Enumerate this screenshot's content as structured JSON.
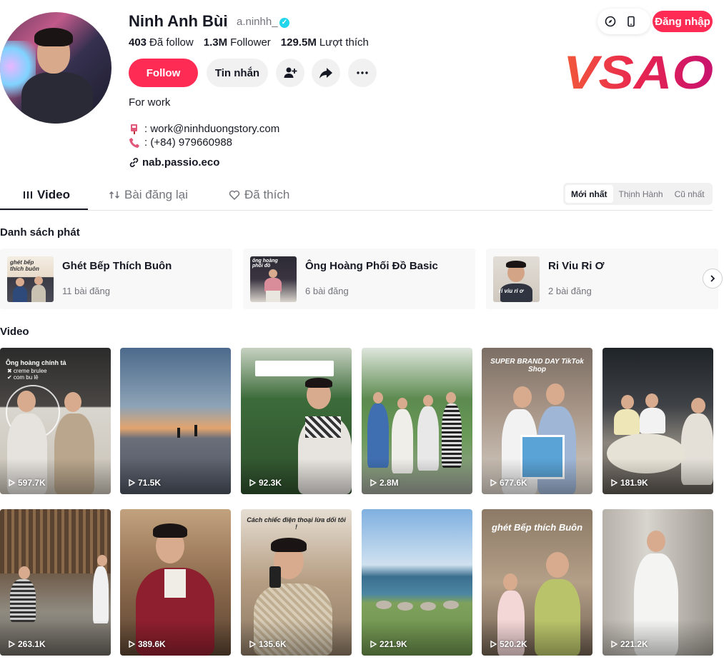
{
  "profile": {
    "name": "Ninh Anh Bùi",
    "handle": "a.ninhh_",
    "stats": [
      {
        "value": "403",
        "label": "Đã follow"
      },
      {
        "value": "1.3M",
        "label": "Follower"
      },
      {
        "value": "129.5M",
        "label": "Lượt thích"
      }
    ],
    "follow_label": "Follow",
    "message_label": "Tin nhắn",
    "bio": "For work",
    "email": ": work@ninhduongstory.com",
    "phone": ": (+84) 979660988",
    "link": "nab.passio.eco"
  },
  "topbar": {
    "login_label": "Đăng nhập"
  },
  "logo_text": "VSAO",
  "tabs": [
    {
      "label": "Video"
    },
    {
      "label": "Bài đăng lại"
    },
    {
      "label": "Đã thích"
    }
  ],
  "sort": [
    "Mới nhất",
    "Thịnh Hành",
    "Cũ nhất"
  ],
  "playlist_section": "Danh sách phát",
  "playlists": [
    {
      "title": "Ghét Bếp Thích Buôn",
      "count": "11 bài đăng"
    },
    {
      "title": "Ông Hoàng Phối Đồ Basic",
      "count": "6 bài đăng"
    },
    {
      "title": "Ri Viu Ri Ơ",
      "count": "2 bài đăng"
    }
  ],
  "video_section": "Video",
  "videos": [
    {
      "views": "597.7K",
      "caption": "Ông hoàng chính tả"
    },
    {
      "views": "71.5K",
      "caption": ""
    },
    {
      "views": "92.3K",
      "caption": ""
    },
    {
      "views": "2.8M",
      "caption": ""
    },
    {
      "views": "677.6K",
      "caption": "SUPER BRAND DAY TikTok Shop"
    },
    {
      "views": "181.9K",
      "caption": ""
    },
    {
      "views": "263.1K",
      "caption": ""
    },
    {
      "views": "389.6K",
      "caption": ""
    },
    {
      "views": "135.6K",
      "caption": "Cách chiếc điện thoại lừa dối tôi !"
    },
    {
      "views": "221.9K",
      "caption": ""
    },
    {
      "views": "520.2K",
      "caption": "ghét Bếp thích Buôn"
    },
    {
      "views": "221.2K",
      "caption": ""
    }
  ],
  "colors": {
    "accent": "#fe2c55",
    "verified": "#20d5ec"
  }
}
